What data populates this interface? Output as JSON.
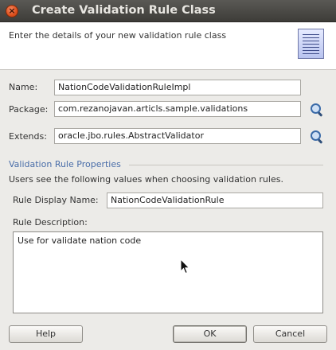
{
  "window": {
    "title": "Create Validation Rule Class",
    "close_glyph": "×"
  },
  "header": {
    "description": "Enter the details of your new validation rule class",
    "icon": "document-lines-icon"
  },
  "form": {
    "name_label": "Name:",
    "name_value": "NationCodeValidationRuleImpl",
    "package_label": "Package:",
    "package_value": "com.rezanojavan.articls.sample.validations",
    "extends_label": "Extends:",
    "extends_value": "oracle.jbo.rules.AbstractValidator"
  },
  "properties": {
    "section_title": "Validation Rule Properties",
    "section_desc": "Users see the following values when choosing validation rules.",
    "display_name_label": "Rule Display Name:",
    "display_name_value": "NationCodeValidationRule",
    "description_label": "Rule Description:",
    "description_value": "Use for validate nation code"
  },
  "buttons": {
    "help": "Help",
    "ok": "OK",
    "cancel": "Cancel"
  },
  "colors": {
    "section_title": "#4a6ea9",
    "close_button": "#dd4f1c"
  }
}
